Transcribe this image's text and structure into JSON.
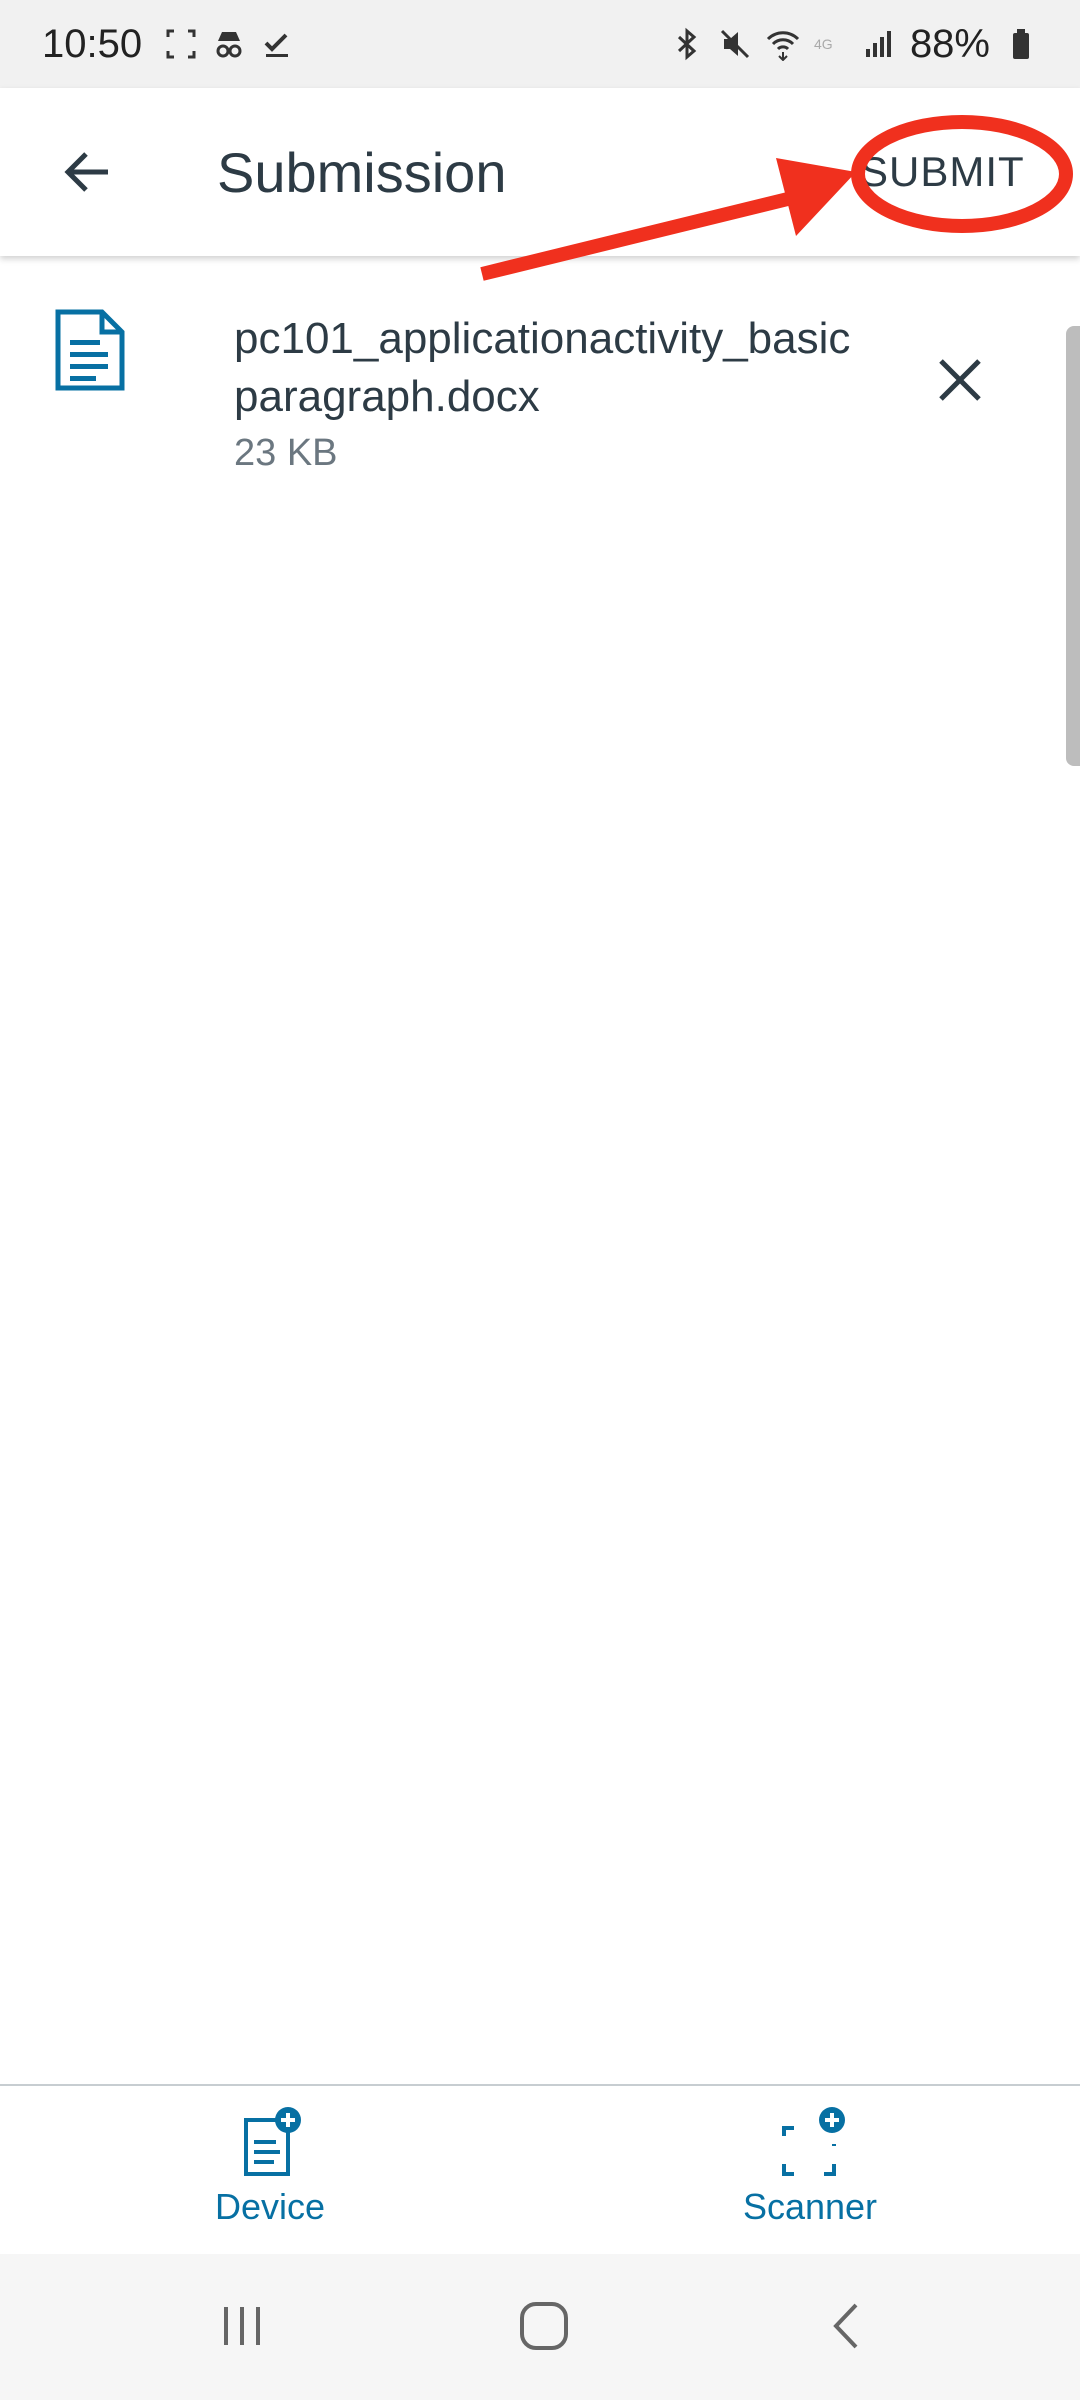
{
  "status_bar": {
    "time": "10:50",
    "battery": "88%",
    "icons_left": [
      "screenshot-icon",
      "incognito-icon",
      "check-icon"
    ],
    "icons_right": [
      "bluetooth-icon",
      "mute-icon",
      "wifi-icon",
      "volte-icon",
      "signal-icon",
      "battery-icon"
    ]
  },
  "app_bar": {
    "title": "Submission",
    "submit_label": "SUBMIT",
    "back_icon": "back-arrow-icon"
  },
  "files": [
    {
      "name": "pc101_applicationactivity_basicparagraph.docx",
      "size": "23 KB",
      "icon": "document-icon",
      "remove_icon": "close-icon"
    }
  ],
  "bottom_bar": {
    "device_label": "Device",
    "scanner_label": "Scanner"
  },
  "colors": {
    "accent": "#0770a3",
    "text": "#2d3b45",
    "annotation": "#f0301e"
  }
}
